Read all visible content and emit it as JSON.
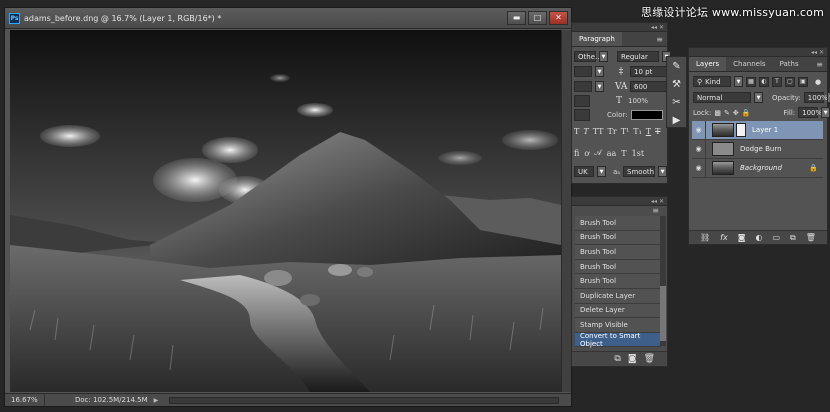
{
  "watermark": "思缘设计论坛 www.missyuan.com",
  "document": {
    "title": "adams_before.dng @ 16.7% (Layer 1, RGB/16*) *",
    "window_buttons": {
      "minimize": "▬",
      "maximize": "□",
      "close": "✕"
    },
    "zoom": "16.67%",
    "doc_size": "Doc: 102.5M/214.5M"
  },
  "character_panel": {
    "tabs": [
      "Paragraph"
    ],
    "font_family": "Othe...",
    "font_style": "Regular",
    "font_size": "10 pt",
    "tracking": "600",
    "vertical_scale": "100%",
    "color_label": "Color:",
    "type_buttons": [
      "T",
      "T",
      "TT",
      "Tr",
      "T¹",
      "T₁",
      "T",
      "T"
    ],
    "lang_value": "UK",
    "antialias": "Smooth",
    "aa_label": "aₐ"
  },
  "history": {
    "items": [
      {
        "label": "Brush Tool",
        "active": false
      },
      {
        "label": "Brush Tool",
        "active": false
      },
      {
        "label": "Brush Tool",
        "active": false
      },
      {
        "label": "Brush Tool",
        "active": false
      },
      {
        "label": "Brush Tool",
        "active": false
      },
      {
        "label": "Duplicate Layer",
        "active": false
      },
      {
        "label": "Delete Layer",
        "active": false
      },
      {
        "label": "Stamp Visible",
        "active": false
      },
      {
        "label": "Convert to Smart Object",
        "active": true
      }
    ]
  },
  "layers_panel": {
    "tabs": [
      "Layers",
      "Channels",
      "Paths"
    ],
    "filter_kind": "Kind",
    "blend_mode": "Normal",
    "opacity_label": "Opacity:",
    "opacity_value": "100%",
    "lock_label": "Lock:",
    "fill_label": "Fill:",
    "fill_value": "100%",
    "layers": [
      {
        "name": "Layer 1",
        "active": true,
        "italic": false,
        "thumb": "image",
        "smart": true
      },
      {
        "name": "Dodge Burn",
        "active": false,
        "italic": false,
        "thumb": "gray",
        "smart": false
      },
      {
        "name": "Background",
        "active": false,
        "italic": true,
        "thumb": "image",
        "locked": true
      }
    ],
    "footer_icons": [
      "link-icon",
      "fx-icon",
      "mask-icon",
      "adjustment-icon",
      "group-icon",
      "new-layer-icon",
      "trash-icon"
    ]
  },
  "colors": {
    "ui_bg": "#535353",
    "workspace": "#262626",
    "selection": "#7e95b5",
    "history_selection": "#3e5f8a"
  }
}
